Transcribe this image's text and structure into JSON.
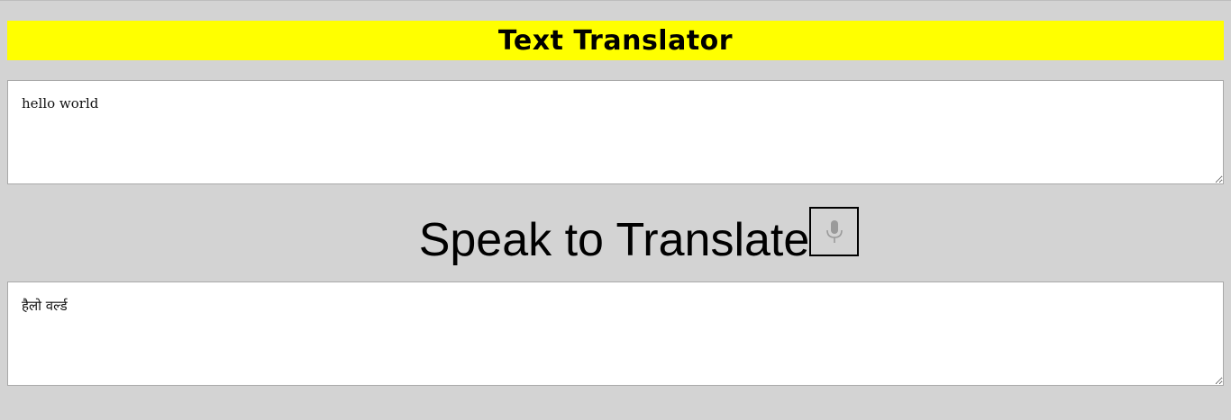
{
  "header": {
    "title": "Text Translator"
  },
  "source": {
    "value": "hello world"
  },
  "speak": {
    "label": "Speak to Translate",
    "icon": "microphone-icon"
  },
  "target": {
    "value": "हैलो वर्ल्ड"
  },
  "colors": {
    "background": "#d3d3d3",
    "title_bar": "#ffff00",
    "mic_icon": "#9a9a9a"
  }
}
